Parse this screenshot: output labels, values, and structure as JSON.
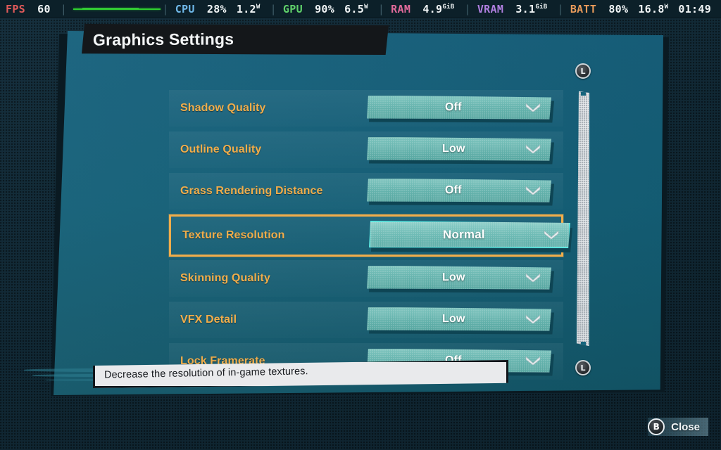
{
  "perf_overlay": {
    "items": [
      {
        "label": "FPS",
        "label_color": "#e05a5a",
        "value": "60",
        "unit": "",
        "graph": true
      },
      {
        "label": "CPU",
        "label_color": "#6fb8e8",
        "value": "28%",
        "unit": "",
        "graph": false
      },
      {
        "label": "",
        "label_color": "",
        "value": "1.2",
        "unit": "W",
        "graph": false
      },
      {
        "label": "GPU",
        "label_color": "#5fd06a",
        "value": "90%",
        "unit": "",
        "graph": false
      },
      {
        "label": "",
        "label_color": "",
        "value": "6.5",
        "unit": "W",
        "graph": false
      },
      {
        "label": "RAM",
        "label_color": "#e06a9a",
        "value": "4.9",
        "unit": "GiB",
        "graph": false
      },
      {
        "label": "VRAM",
        "label_color": "#b07fe0",
        "value": "3.1",
        "unit": "GiB",
        "graph": false
      },
      {
        "label": "BATT",
        "label_color": "#e89a5a",
        "value": "80%",
        "unit": "",
        "graph": false
      },
      {
        "label": "",
        "label_color": "",
        "value": "16.8",
        "unit": "W",
        "graph": false
      },
      {
        "label": "",
        "label_color": "",
        "value": "01:49",
        "unit": "",
        "graph": false
      }
    ]
  },
  "window": {
    "title": "Graphics Settings"
  },
  "settings": {
    "rows": [
      {
        "label": "Shadow Quality",
        "value": "Off",
        "selected": false
      },
      {
        "label": "Outline Quality",
        "value": "Low",
        "selected": false
      },
      {
        "label": "Grass Rendering Distance",
        "value": "Off",
        "selected": false
      },
      {
        "label": "Texture Resolution",
        "value": "Normal",
        "selected": true
      },
      {
        "label": "Skinning Quality",
        "value": "Low",
        "selected": false
      },
      {
        "label": "VFX Detail",
        "value": "Low",
        "selected": false
      },
      {
        "label": "Lock Framerate",
        "value": "Off",
        "selected": false
      }
    ]
  },
  "scrollbar": {
    "top_bumper_label": "L",
    "bottom_bumper_label": "L"
  },
  "tooltip": {
    "text": "Decrease the resolution of in-game textures."
  },
  "footer": {
    "close_key": "B",
    "close_label": "Close"
  },
  "colors": {
    "panel_teal": "#146078",
    "label_orange": "#f0ad4b",
    "dropdown_teal": "#64b2ac",
    "highlight_cyan": "#5fe8e0",
    "backdrop_navy": "#132d3b"
  }
}
